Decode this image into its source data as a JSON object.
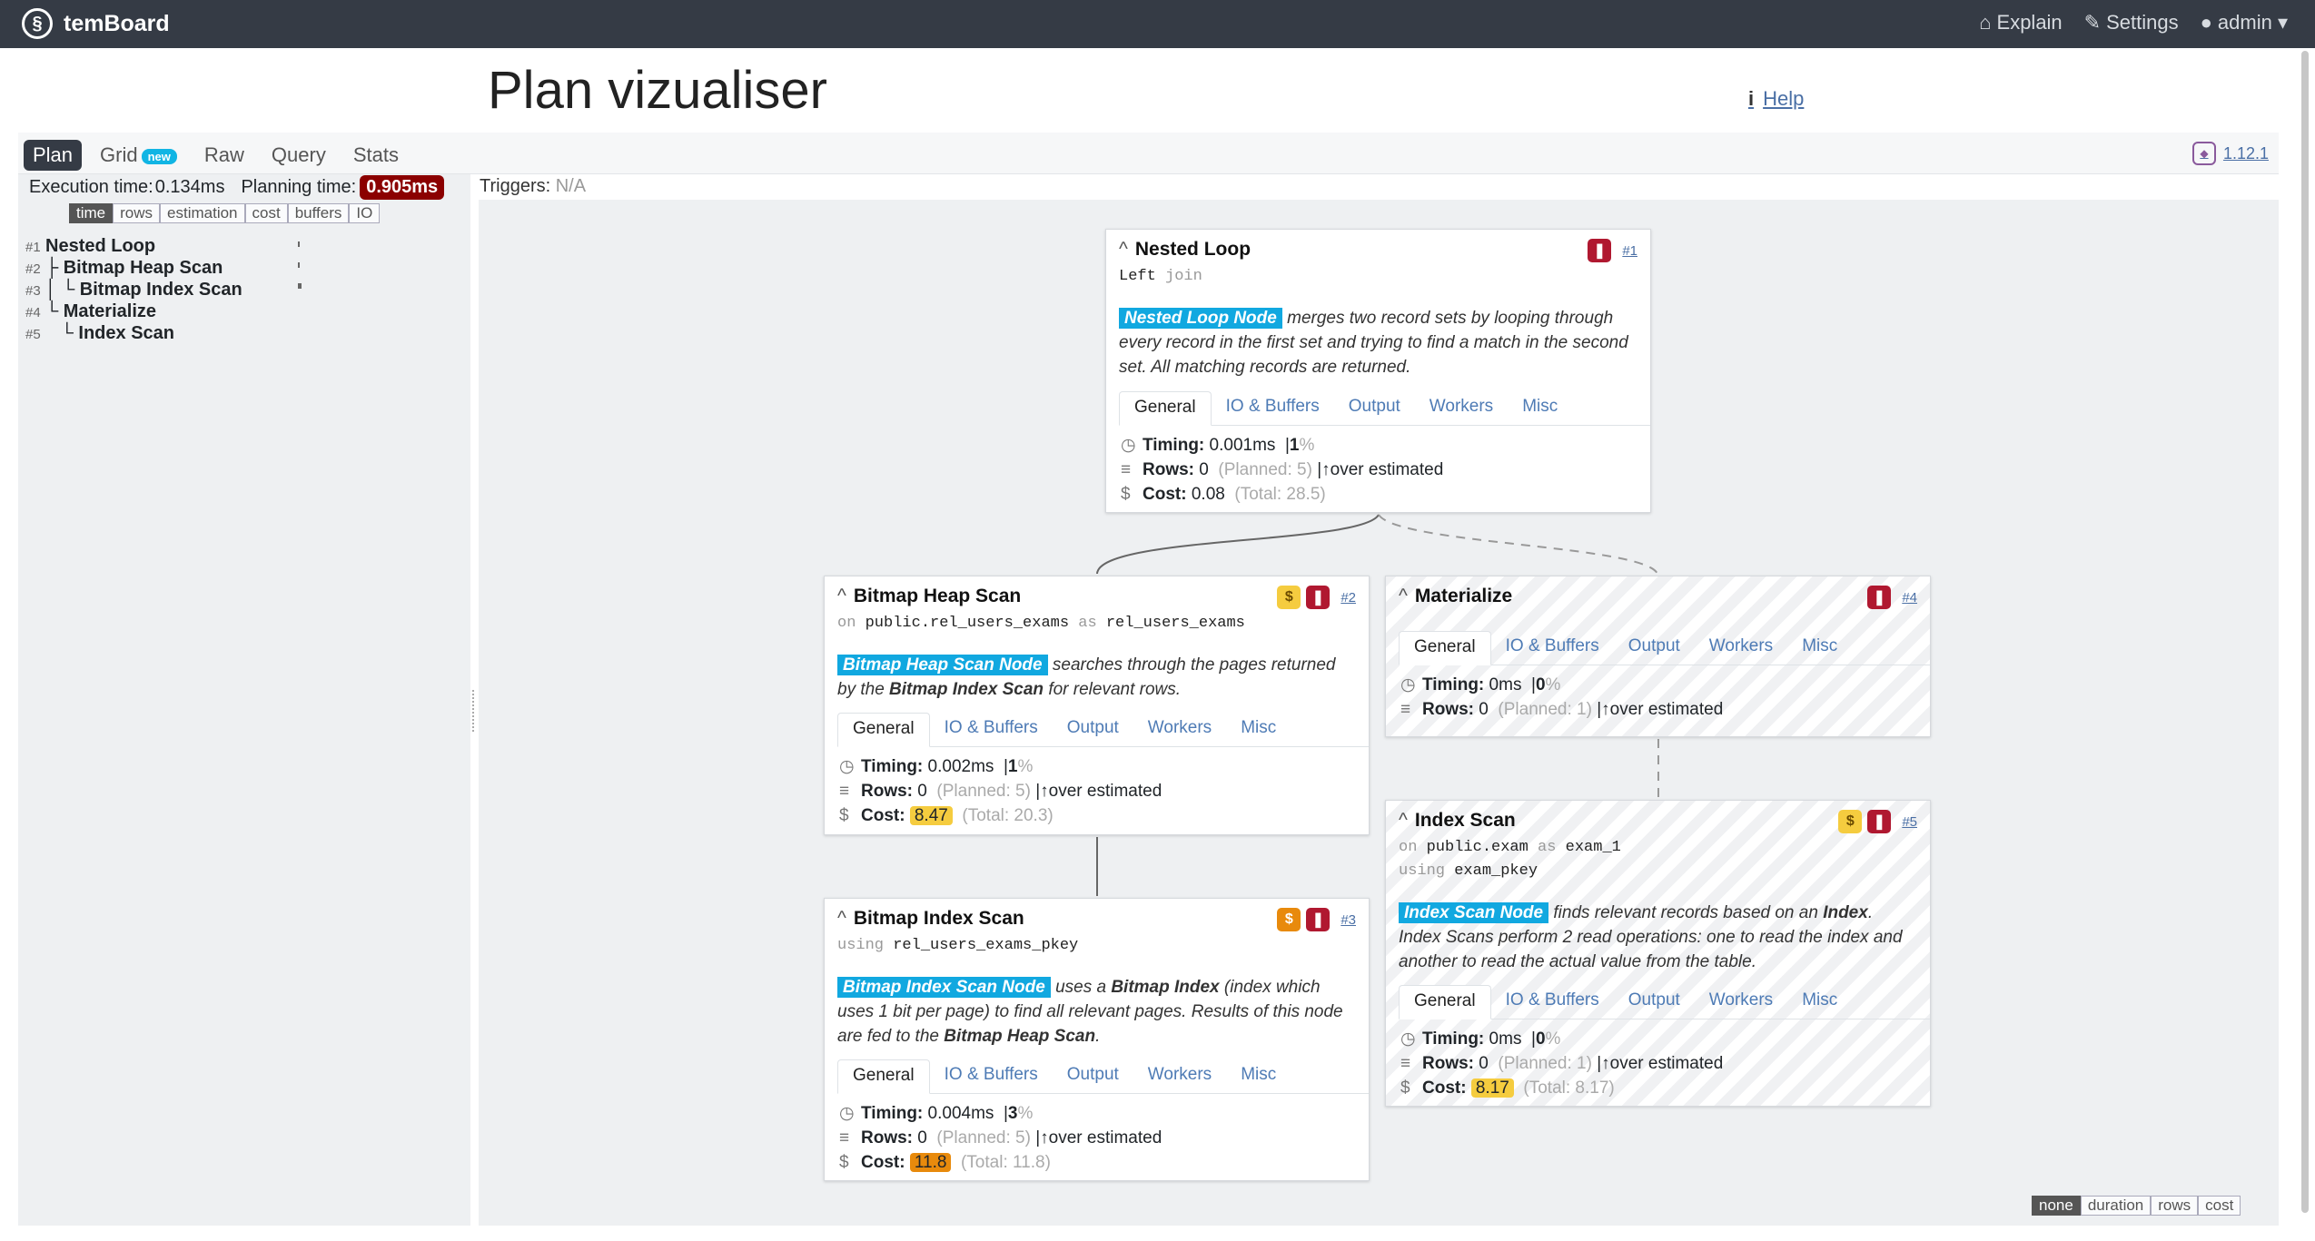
{
  "navbar": {
    "brand": "temBoard",
    "explain": "Explain",
    "settings": "Settings",
    "user": "admin"
  },
  "page": {
    "title": "Plan vizualiser",
    "help": "Help",
    "version": "1.12.1"
  },
  "tabs": [
    {
      "label": "Plan",
      "active": true
    },
    {
      "label": "Grid",
      "badge": "new"
    },
    {
      "label": "Raw"
    },
    {
      "label": "Query"
    },
    {
      "label": "Stats"
    }
  ],
  "summary": {
    "execution_label": "Execution time:",
    "execution_value": "0.134ms",
    "planning_label": "Planning time:",
    "planning_value": "0.905ms",
    "triggers_label": "Triggers:",
    "triggers_value": "N/A"
  },
  "metric_buttons": [
    "time",
    "rows",
    "estimation",
    "cost",
    "buffers",
    "IO"
  ],
  "tree": [
    {
      "num": "#1",
      "prefix": "",
      "name": "Nested Loop"
    },
    {
      "num": "#2",
      "prefix": "├ ",
      "name": "Bitmap Heap Scan"
    },
    {
      "num": "#3",
      "prefix": "│ └ ",
      "name": "Bitmap Index Scan"
    },
    {
      "num": "#4",
      "prefix": "└ ",
      "name": "Materialize"
    },
    {
      "num": "#5",
      "prefix": "   └ ",
      "name": "Index Scan"
    }
  ],
  "node_tabs": [
    "General",
    "IO & Buffers",
    "Output",
    "Workers",
    "Misc"
  ],
  "metric_labels": {
    "timing": "Timing:",
    "rows": "Rows:",
    "cost": "Cost:",
    "over": "over estimated"
  },
  "nodes": {
    "n1": {
      "title": "Nested Loop",
      "num": "#1",
      "sub1": "Left",
      "sub1k": "join",
      "tag": "Nested Loop Node",
      "desc": "merges two record sets by looping through every record in the first set and trying to find a match in the second set. All matching records are returned.",
      "timing": "0.001ms",
      "timing_pct": "1",
      "rows": "0",
      "planned": "(Planned: 5)",
      "cost": "0.08",
      "total": "(Total: 28.5)"
    },
    "n2": {
      "title": "Bitmap Heap Scan",
      "num": "#2",
      "on": "on",
      "rel": "public.rel_users_exams",
      "as": "as",
      "alias": "rel_users_exams",
      "tag": "Bitmap Heap Scan Node",
      "desc_a": "searches through the pages returned by the",
      "desc_b": "Bitmap Index Scan",
      "desc_c": "for relevant rows.",
      "timing": "0.002ms",
      "timing_pct": "1",
      "rows": "0",
      "planned": "(Planned: 5)",
      "cost": "8.47",
      "total": "(Total: 20.3)"
    },
    "n3": {
      "title": "Bitmap Index Scan",
      "num": "#3",
      "using": "using",
      "index": "rel_users_exams_pkey",
      "tag": "Bitmap Index Scan Node",
      "desc_a": "uses a",
      "desc_b": "Bitmap Index",
      "desc_c": "(index which uses 1 bit per page) to find all relevant pages. Results of this node are fed to the",
      "desc_d": "Bitmap Heap Scan",
      "desc_e": ".",
      "timing": "0.004ms",
      "timing_pct": "3",
      "rows": "0",
      "planned": "(Planned: 5)",
      "cost": "11.8",
      "total": "(Total: 11.8)"
    },
    "n4": {
      "title": "Materialize",
      "num": "#4",
      "timing": "0ms",
      "timing_pct": "0",
      "rows": "0",
      "planned": "(Planned: 1)"
    },
    "n5": {
      "title": "Index Scan",
      "num": "#5",
      "on": "on",
      "rel": "public.exam",
      "as": "as",
      "alias": "exam_1",
      "using": "using",
      "index": "exam_pkey",
      "tag": "Index Scan Node",
      "desc_a": "finds relevant records based on an",
      "desc_b": "Index",
      "desc_c": ". Index Scans perform 2 read operations: one to read the index and another to read the actual value from the table.",
      "timing": "0ms",
      "timing_pct": "0",
      "rows": "0",
      "planned": "(Planned: 1)",
      "cost": "8.17",
      "total": "(Total: 8.17)"
    }
  },
  "highlight_buttons": [
    "none",
    "duration",
    "rows",
    "cost"
  ],
  "colors": {
    "navbar": "#353b45",
    "planning_badge": "#8b0000",
    "node_tag": "#11a8e0",
    "cost_yellow": "#f5cc3f",
    "cost_orange": "#e88a0c",
    "time_red": "#b01830"
  }
}
